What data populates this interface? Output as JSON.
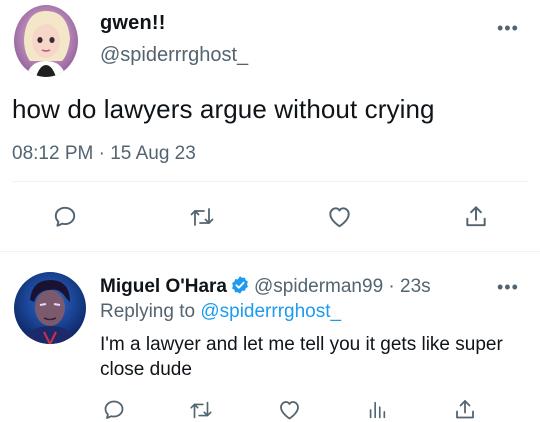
{
  "tweet": {
    "display_name": "gwen!!",
    "handle": "@spiderrrghost_",
    "text": "how do lawyers argue without crying",
    "timestamp": "08:12 PM · 15 Aug 23",
    "more_label": "•••",
    "avatar_icon": "user-avatar-gwen",
    "actions": [
      "reply-icon",
      "retweet-icon",
      "like-icon",
      "share-icon"
    ]
  },
  "reply": {
    "display_name": "Miguel O'Hara",
    "verified_icon": "verified-badge-icon",
    "handle": "@spiderman99",
    "separator": "·",
    "age": "23s",
    "replying_prefix": "Replying to",
    "replying_handle": "@spiderrrghost_",
    "text": "I'm a lawyer and let me tell you it gets like super close dude",
    "more_label": "•••",
    "avatar_icon": "user-avatar-miguel",
    "actions": [
      "reply-icon",
      "retweet-icon",
      "like-icon",
      "views-icon",
      "share-icon"
    ]
  },
  "colors": {
    "text": "#0f1419",
    "secondary": "#536471",
    "link": "#1d9bf0",
    "divider": "#eff3f4"
  }
}
